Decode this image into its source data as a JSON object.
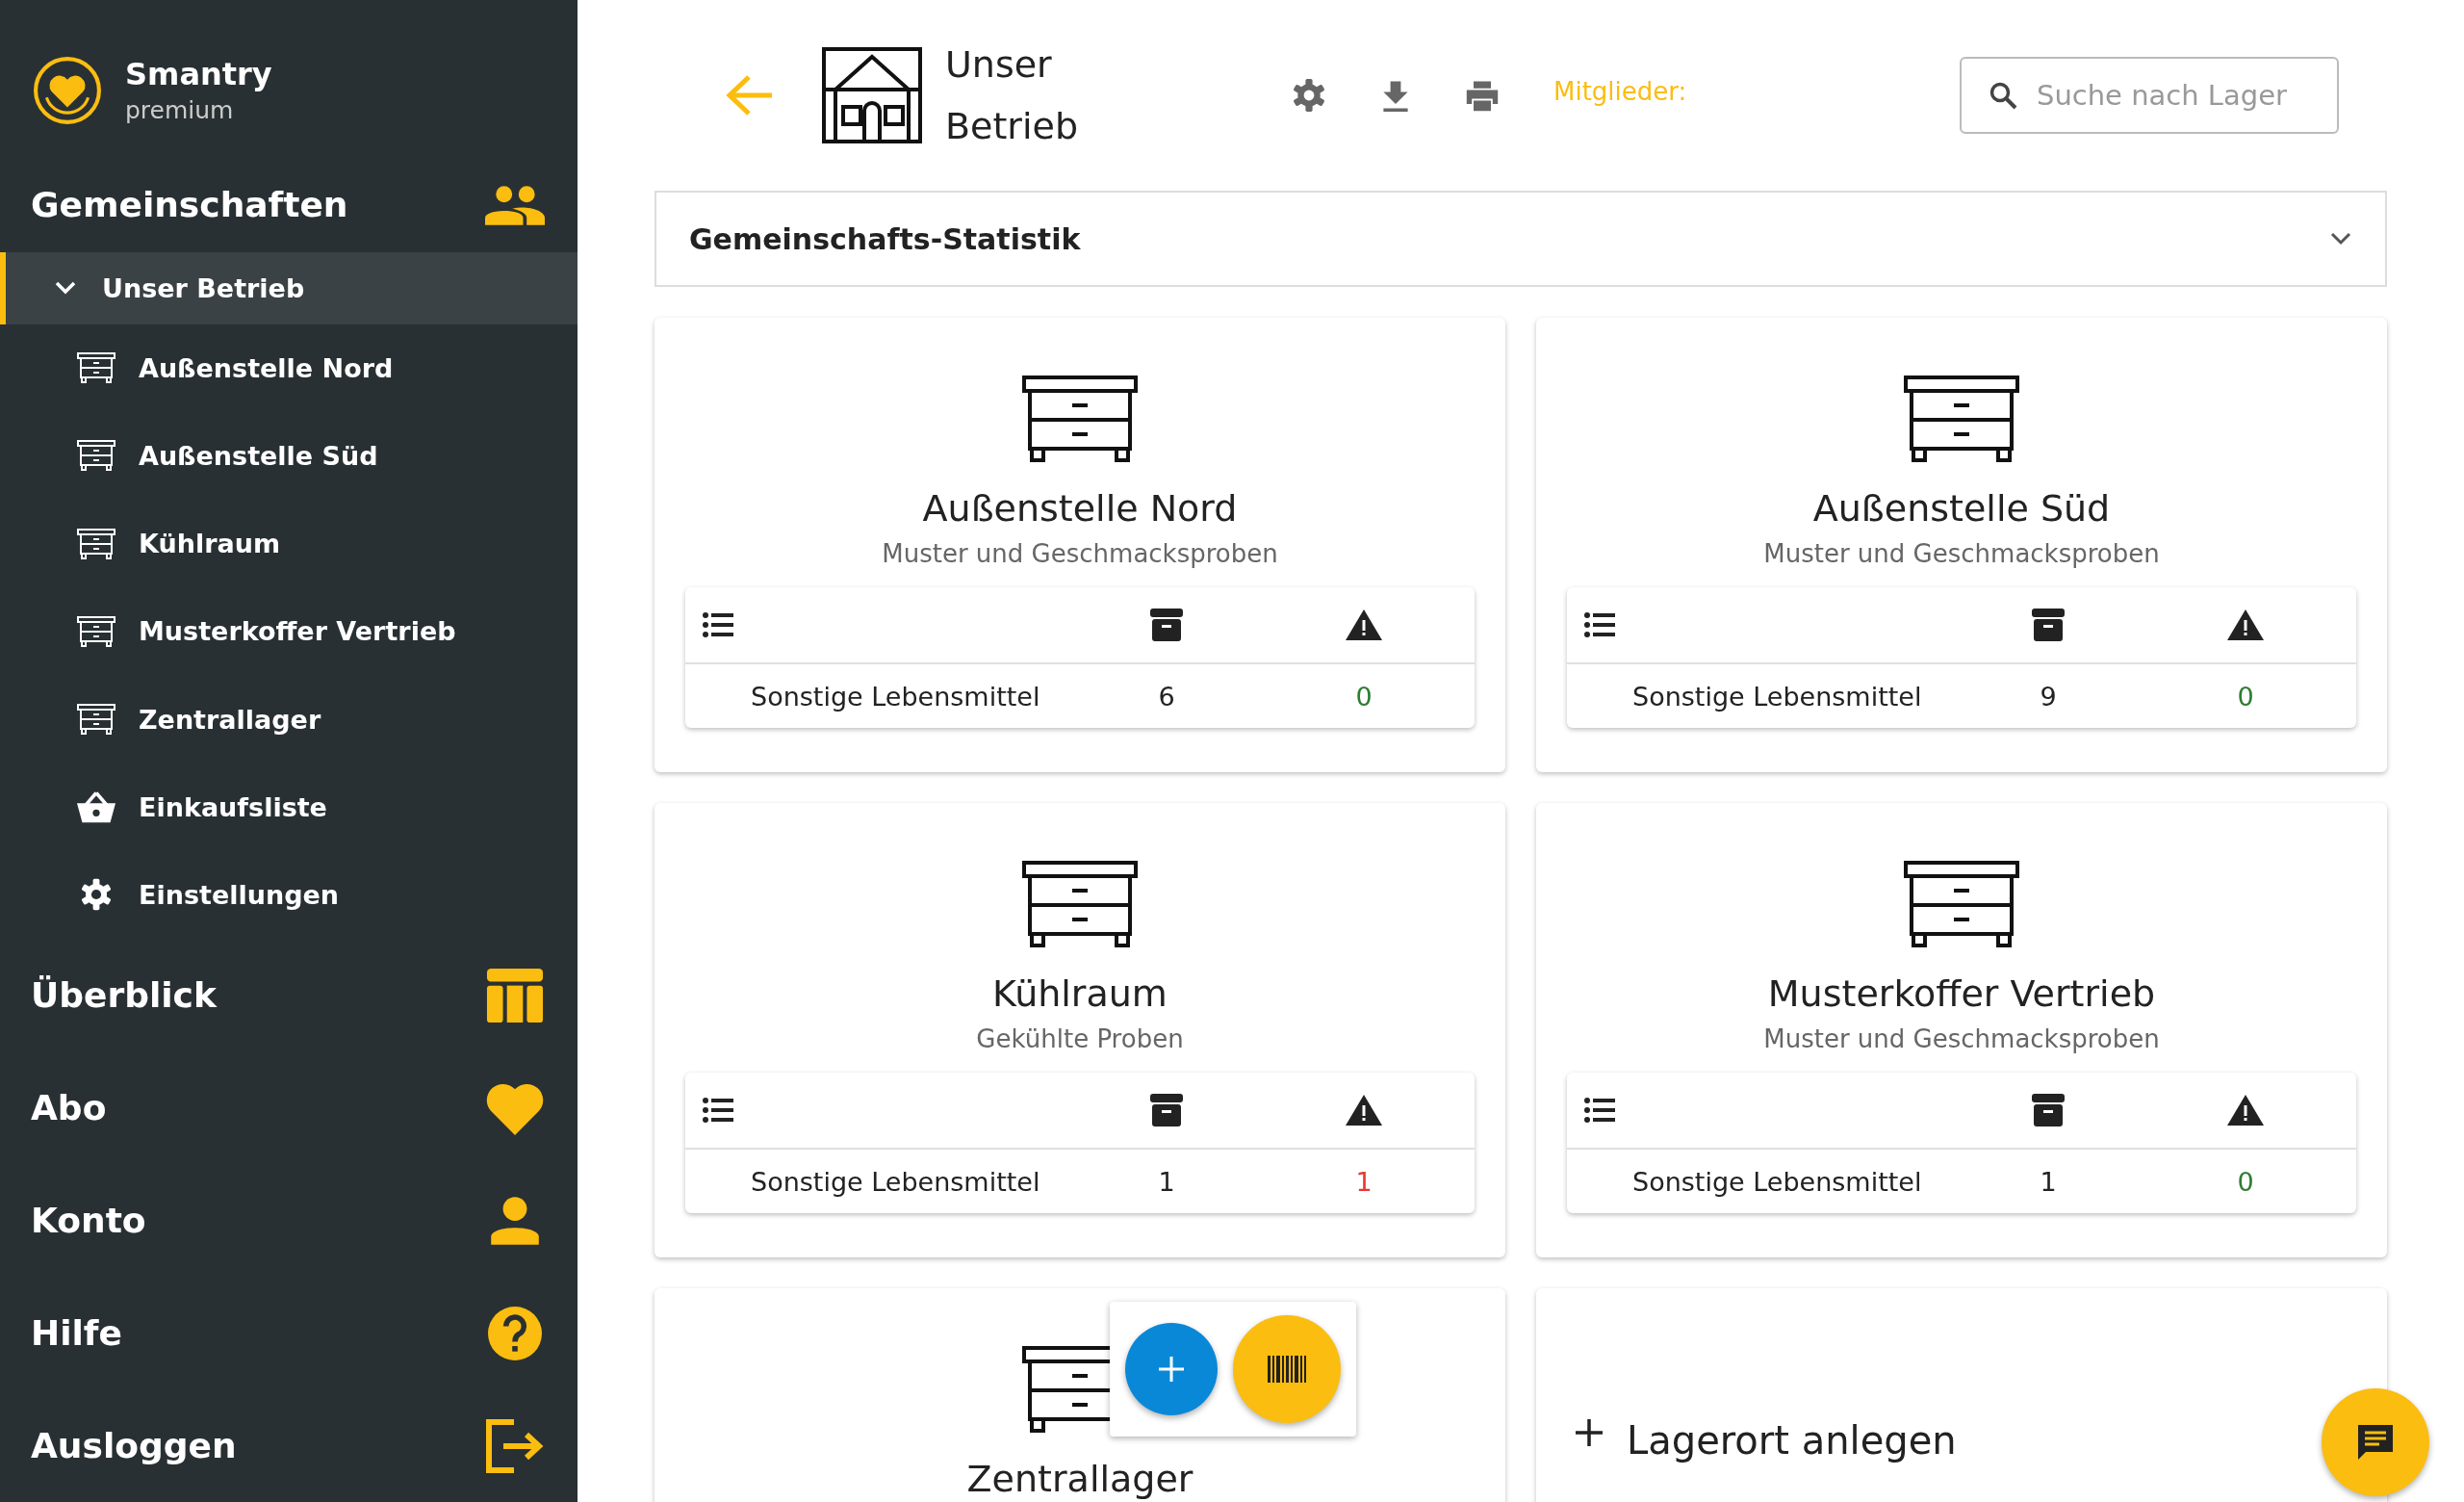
{
  "sidebar": {
    "app_name": "Smantry",
    "plan": "premium",
    "sections": [
      {
        "kind": "communities",
        "label": "Gemeinschaften",
        "children": [
          {
            "label": "Unser Betrieb",
            "expanded": true,
            "selected": true,
            "children": [
              {
                "kind": "storage",
                "label": "Außenstelle Nord"
              },
              {
                "kind": "storage",
                "label": "Außenstelle Süd"
              },
              {
                "kind": "storage",
                "label": "Kühlraum"
              },
              {
                "kind": "storage",
                "label": "Musterkoffer Vertrieb"
              },
              {
                "kind": "storage",
                "label": "Zentrallager"
              },
              {
                "kind": "shopping",
                "label": "Einkaufsliste"
              },
              {
                "kind": "settings",
                "label": "Einstellungen"
              }
            ]
          }
        ]
      },
      {
        "kind": "overview",
        "label": "Überblick"
      },
      {
        "kind": "subscription",
        "label": "Abo"
      },
      {
        "kind": "account",
        "label": "Konto"
      },
      {
        "kind": "help",
        "label": "Hilfe"
      },
      {
        "kind": "logout",
        "label": "Ausloggen"
      }
    ]
  },
  "header": {
    "title": "Unser Betrieb",
    "members_label": "Mitglieder:",
    "search": {
      "placeholder": "Suche nach Lager"
    }
  },
  "statistics": {
    "title": "Gemeinschafts-Statistik",
    "expanded": false
  },
  "storages": [
    {
      "name": "Außenstelle Nord",
      "description": "Muster und Geschmacksproben",
      "rows": [
        {
          "category": "Sonstige Lebensmittel",
          "count": "6",
          "warnings": "0",
          "alert": false
        }
      ]
    },
    {
      "name": "Außenstelle Süd",
      "description": "Muster und Geschmacksproben",
      "rows": [
        {
          "category": "Sonstige Lebensmittel",
          "count": "9",
          "warnings": "0",
          "alert": false
        }
      ]
    },
    {
      "name": "Kühlraum",
      "description": "Gekühlte Proben",
      "rows": [
        {
          "category": "Sonstige Lebensmittel",
          "count": "1",
          "warnings": "1",
          "alert": true
        }
      ]
    },
    {
      "name": "Musterkoffer Vertrieb",
      "description": "Muster und Geschmacksproben",
      "rows": [
        {
          "category": "Sonstige Lebensmittel",
          "count": "1",
          "warnings": "0",
          "alert": false
        }
      ]
    },
    {
      "name": "Zentrallager"
    }
  ],
  "add_storage": {
    "label": "Lagerort anlegen"
  }
}
